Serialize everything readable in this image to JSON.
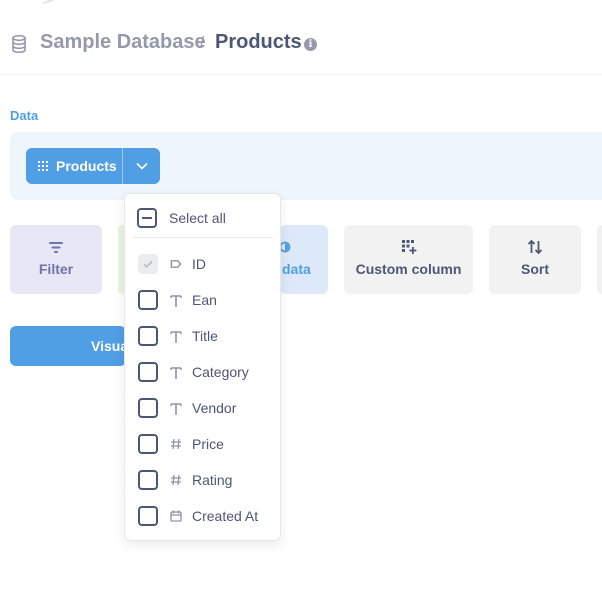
{
  "header": {
    "database": "Sample Database",
    "separator": "/",
    "table": "Products",
    "info_glyph": "i"
  },
  "editor": {
    "data_label": "Data",
    "source_table": "Products"
  },
  "actions": {
    "filter": "Filter",
    "join_partial": "data",
    "custom_column": "Custom column",
    "sort": "Sort"
  },
  "visualize_partial": "Visua",
  "column_picker": {
    "select_all": "Select all",
    "columns": [
      {
        "name": "ID",
        "type_icon": "key-tag-icon",
        "checked": true,
        "disabled": true
      },
      {
        "name": "Ean",
        "type_icon": "text-icon",
        "checked": false
      },
      {
        "name": "Title",
        "type_icon": "text-icon",
        "checked": false
      },
      {
        "name": "Category",
        "type_icon": "text-icon",
        "checked": false
      },
      {
        "name": "Vendor",
        "type_icon": "text-icon",
        "checked": false
      },
      {
        "name": "Price",
        "type_icon": "number-icon",
        "checked": false
      },
      {
        "name": "Rating",
        "type_icon": "number-icon",
        "checked": false
      },
      {
        "name": "Created At",
        "type_icon": "calendar-icon",
        "checked": false
      }
    ]
  },
  "colors": {
    "brand": "#509ee3",
    "text": "#4c5773",
    "muted": "#949aab",
    "filter": "#7172ad"
  }
}
